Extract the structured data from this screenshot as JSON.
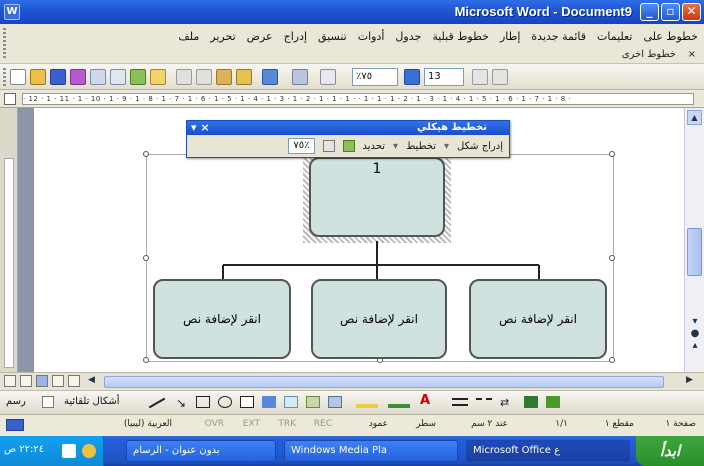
{
  "window": {
    "title": "Microsoft Word - Document9",
    "minimize_label": "_",
    "maximize_label": "▫",
    "close_label": "✕"
  },
  "menu": {
    "items": [
      "ملف",
      "تحرير",
      "عرض",
      "إدراج",
      "تنسيق",
      "أدوات",
      "جدول",
      "خطوط قبلية",
      "إطار",
      "قائمة جديدة",
      "تعليمات",
      "خطوط على"
    ],
    "sub_label": "خطوط اخرى",
    "sub_close": "×"
  },
  "toolbar": {
    "zoom_value": "٪٧٥",
    "font_size_value": "13"
  },
  "ruler": {
    "text": "· 12 · 1 · 11 · 1 · 10 · 1 · 9 · 1 · 8 · 1 · 7 · 1 · 6 · 1 · 5 · 1 · 4 · 1 · 3 · 1 · 2 · 1 · 1 · 1 ·  · 1 · 1 · 1 · 2 · 1 · 3 · 1 · 4 · 1 · 5 · 1 · 6 · 1 · 7 · 1 · 8 ·"
  },
  "diagram_toolbar": {
    "title": "تخطيط هيكلي",
    "insert_shape": "إدراج شكل",
    "layout": "تخطيط",
    "select": "تحديد",
    "zoom": "٪٧٥"
  },
  "diagram": {
    "top_box_text": "1",
    "child_boxes": [
      {
        "text": "انقر لإضافة نص"
      },
      {
        "text": "انقر لإضافة نص"
      },
      {
        "text": "انقر لإضافة نص"
      }
    ]
  },
  "drawing_toolbar": {
    "draw_label": "رسم",
    "autoshapes_label": "أشكال تلقائية"
  },
  "status": {
    "page": "صفحة ١",
    "section": "مقطع ١",
    "page_of": "١/١",
    "position": "عند ٢ سم",
    "line": "سطر",
    "column": "عمود",
    "rec": "REC",
    "trk": "TRK",
    "ext": "EXT",
    "ovr": "OVR",
    "language": "العربية (ليبيا)"
  },
  "taskbar": {
    "start": "ابدأ",
    "tasks": [
      {
        "label": "Microsoft Office ع"
      },
      {
        "label": "Windows Media Pla"
      },
      {
        "label": "بدون عنوان - الرسام"
      }
    ],
    "clock": "٢٢:٢٤ ص"
  },
  "colors": {
    "titlebar": "#1e55d2",
    "box_fill": "#cfe2e0",
    "taskbar": "#245edb"
  }
}
